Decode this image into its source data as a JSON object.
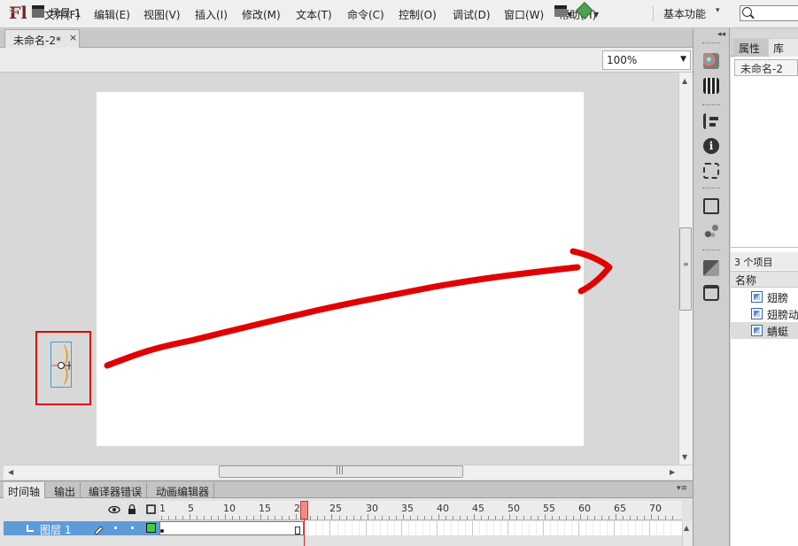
{
  "app": {
    "logo": "Fl"
  },
  "menu": [
    "文件(F)",
    "编辑(E)",
    "视图(V)",
    "插入(I)",
    "修改(M)",
    "文本(T)",
    "命令(C)",
    "控制(O)",
    "调试(D)",
    "窗口(W)",
    "帮助(H)"
  ],
  "workspace": {
    "label": "基本功能",
    "caret": "▾"
  },
  "document": {
    "tab_title": "未命名-2*",
    "close": "×"
  },
  "editbar": {
    "back": "⇦",
    "scene": "场景 1",
    "zoom": "100%",
    "caret": "▼"
  },
  "bottom_tabs": [
    "时间轴",
    "输出",
    "编译器错误",
    "动画编辑器"
  ],
  "panel_menu": "▾≡",
  "timeline": {
    "frame_numbers": [
      "1",
      "5",
      "10",
      "15",
      "20",
      "25",
      "30",
      "35",
      "40",
      "45",
      "50",
      "55",
      "60",
      "65",
      "70"
    ],
    "layer_name": "图层 1",
    "current_frame": 21
  },
  "scroll": {
    "up": "▲",
    "down": "▼",
    "left": "◀",
    "right": "▶",
    "grip_v": "≡",
    "grip_h": "|||"
  },
  "toolbar_collapse": "◂◂",
  "library": {
    "tab_properties": "属性",
    "tab_library": "库",
    "doc_select": "未命名-2",
    "count": "3 个项目",
    "column_name": "名称",
    "items": [
      {
        "label": "翅膀",
        "selected": false
      },
      {
        "label": "翅膀动",
        "selected": false
      },
      {
        "label": "蜻蜓",
        "selected": true
      }
    ]
  },
  "colors": {
    "accent_red": "#e00000",
    "layer_highlight": "#5f9bd8",
    "playhead": "#f28a8a"
  }
}
